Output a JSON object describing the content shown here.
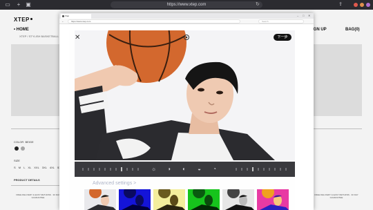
{
  "outer_browser": {
    "url": "https://www.xtep.com",
    "new_tab": "+",
    "colors": {
      "red": "#e0594d",
      "orange": "#e0904d",
      "purple": "#b06fd0",
      "grey": "#888890"
    }
  },
  "site": {
    "logo": "XTEP",
    "nav_home": "HOME",
    "breadcrumb": "XTEP / STYLISH BASKETBALL SPORTS",
    "nav_signup": "SIGN UP",
    "nav_bag": "BAG(0)",
    "color_label": "COLOR",
    "color_value": "BEIGE",
    "size_label": "SIZE",
    "sizes": "S M L XL XXL 3XL 4XL 5XL",
    "product_details": "PRODUCT DETAILS",
    "footer_left": "FREE DELIVERY & EASY RETURNS · 30 DAY GUARANTEE",
    "footer_right": "FREE DELIVERY & EASY RETURNS · 30 DAY GUARANTEE",
    "swatch_colors": [
      "#222222",
      "#a5a5a5"
    ]
  },
  "inner_browser": {
    "tab_title": "Xtep",
    "url": "https://www.xtep.com",
    "search_placeholder": "Search"
  },
  "editor": {
    "close_icon": "close-icon",
    "next_label": "下一步",
    "advanced_settings": "Advanced settings  >",
    "tools": [
      "sun-icon",
      "contrast-icon",
      "half-circle-icon",
      "circle-half-icon"
    ],
    "filters": [
      {
        "name": "original",
        "bg": "#e9e9ec"
      },
      {
        "name": "blue",
        "bg": "#1414d8"
      },
      {
        "name": "yellow",
        "bg": "#f3ee9c"
      },
      {
        "name": "green",
        "bg": "#16c41c"
      },
      {
        "name": "bw",
        "bg": "#2a2a2a"
      },
      {
        "name": "pop",
        "bg": "#e83aa3"
      }
    ]
  }
}
